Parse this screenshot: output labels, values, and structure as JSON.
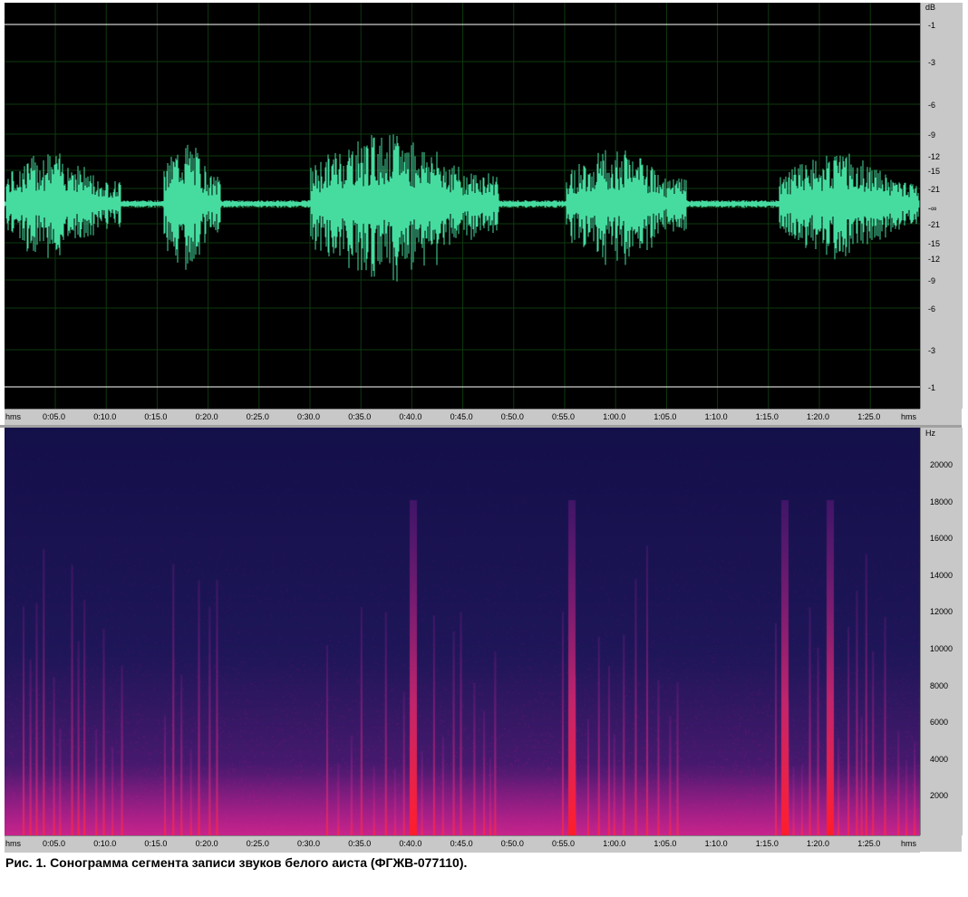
{
  "waveform": {
    "db_unit": "dB",
    "db_ticks_top": [
      "-1",
      "-3",
      "-6",
      "-9",
      "-12",
      "-15",
      "-21",
      "-∞"
    ],
    "db_ticks_bottom": [
      "-21",
      "-15",
      "-12",
      "-9",
      "-6",
      "-3",
      "-1"
    ],
    "colors": {
      "background": "#000000",
      "wave": "#46dca0",
      "grid": "#0e3a0e",
      "clip_line": "#ffffff"
    }
  },
  "spectrogram": {
    "freq_unit": "Hz",
    "freq_ticks": [
      "20000",
      "18000",
      "16000",
      "14000",
      "12000",
      "10000",
      "8000",
      "6000",
      "4000",
      "2000"
    ],
    "colors": {
      "low": "#1a1450",
      "mid": "#8a1a8a",
      "high": "#ff2020"
    }
  },
  "time_axis": {
    "unit_left": "hms",
    "unit_right": "hms",
    "ticks": [
      "0:05.0",
      "0:10.0",
      "0:15.0",
      "0:20.0",
      "0:25.0",
      "0:30.0",
      "0:35.0",
      "0:40.0",
      "0:45.0",
      "0:50.0",
      "0:55.0",
      "1:00.0",
      "1:05.0",
      "1:10.0",
      "1:15.0",
      "1:20.0",
      "1:25.0"
    ]
  },
  "caption": "Рис. 1. Сонограмма сегмента записи звуков белого аиста (ФГЖВ-077110)."
}
